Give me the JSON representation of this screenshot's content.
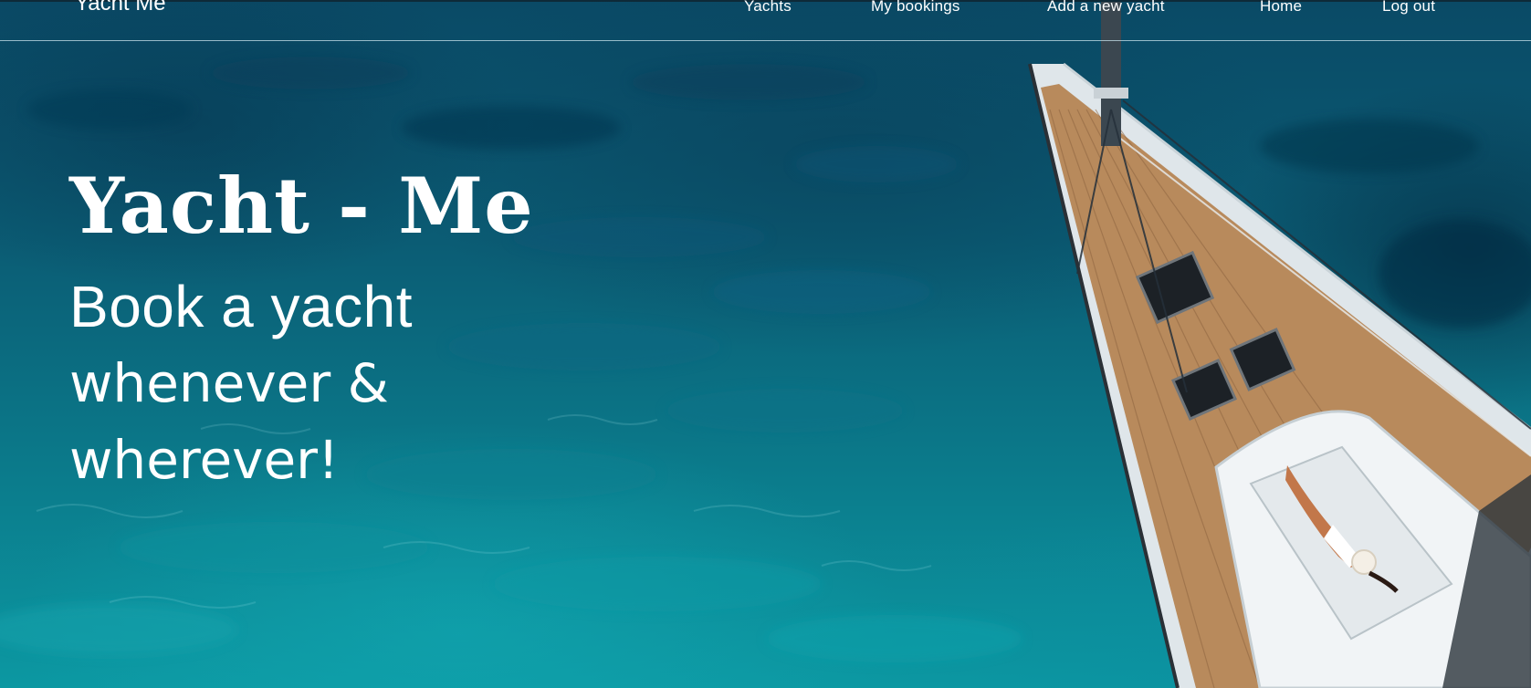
{
  "navbar": {
    "brand": "Yacht Me",
    "links": [
      {
        "label": "Yachts"
      },
      {
        "label": "My bookings"
      },
      {
        "label": "Add a new yacht"
      },
      {
        "label": "Home"
      },
      {
        "label": "Log out"
      }
    ]
  },
  "hero": {
    "title": "Yacht - Me",
    "subtitle_line1": "Book a yacht",
    "subtitle_line2": "whenever &",
    "subtitle_line3": "wherever!"
  },
  "background": {
    "image": "aerial-sailing-yacht-on-turquoise-sea",
    "colors": {
      "deep_water": "#0a4a66",
      "shallow_water": "#0c98a2",
      "deck": "#b98a5a",
      "hull": "#eef2f4"
    }
  }
}
